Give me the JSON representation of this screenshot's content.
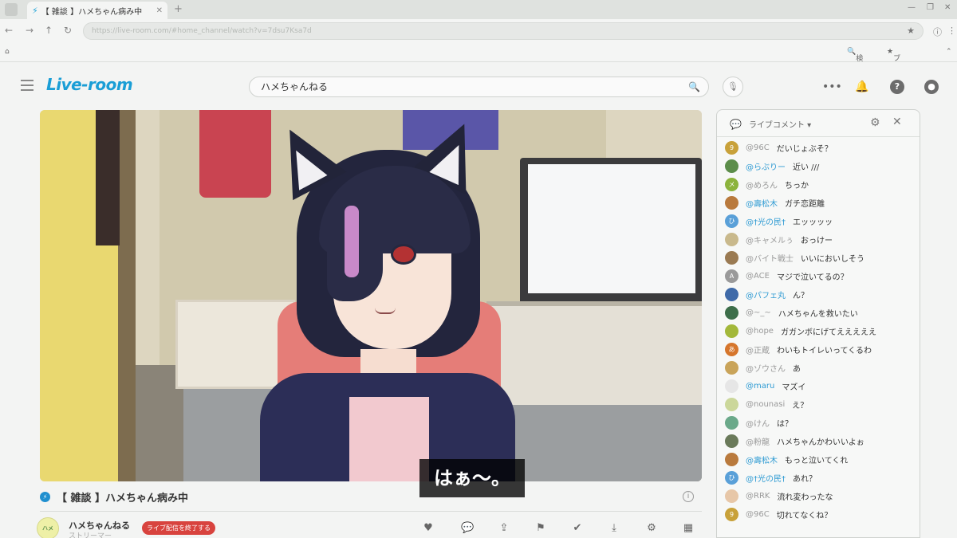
{
  "browser": {
    "tab_label": "【 雑談 】ハメちゃん病み中",
    "url": "https://live-room.com/#home_channel/watch?v=7dsu7Ksa7d",
    "bookmarks": [
      "検索",
      "ブックマーク"
    ]
  },
  "header": {
    "logo": "Live-room",
    "search_value": "ハメちゃんねる"
  },
  "video": {
    "subtitle": "はぁ～。",
    "title": "【 雑談 】ハメちゃん病み中"
  },
  "channel": {
    "avatar_text": "ハメ",
    "name": "ハメちゃんねる",
    "sub": "ストリーマー",
    "end_live_label": "ライブ配信を終了する"
  },
  "actions": [
    "heart-icon",
    "comment-icon",
    "share-icon",
    "flag-icon",
    "check-icon",
    "download-icon",
    "settings-icon",
    "grid-icon"
  ],
  "chat": {
    "title": "ライブコメント ▾",
    "messages": [
      {
        "user": "@96C",
        "text": "だいじょぶそ？",
        "avatar": "9",
        "color": "#c8a13a",
        "hl": false
      },
      {
        "user": "@らぶりー",
        "text": "近い ///",
        "avatar": "",
        "color": "#5c8d4a",
        "hl": true
      },
      {
        "user": "@めろん",
        "text": "ちっか",
        "avatar": "メ",
        "color": "#8cb33c",
        "hl": false
      },
      {
        "user": "@壽松木",
        "text": "ガチ恋距離",
        "avatar": "",
        "color": "#b97a3d",
        "hl": true
      },
      {
        "user": "@†光の民†",
        "text": "エッッッッ",
        "avatar": "ひ",
        "color": "#5aa0d8",
        "hl": true
      },
      {
        "user": "@キャメルぅ",
        "text": "おっけー",
        "avatar": "",
        "color": "#c9b98c",
        "hl": false
      },
      {
        "user": "@バイト戦士",
        "text": "いいにおいしそう",
        "avatar": "",
        "color": "#9a7a52",
        "hl": false
      },
      {
        "user": "@ACE",
        "text": "マジで泣いてるの？",
        "avatar": "A",
        "color": "#9a9a9a",
        "hl": false
      },
      {
        "user": "@パフェ丸",
        "text": "ん？",
        "avatar": "",
        "color": "#3f6aa8",
        "hl": true
      },
      {
        "user": "@~_~",
        "text": "ハメちゃんを救いたい",
        "avatar": "",
        "color": "#3d6e4a",
        "hl": false
      },
      {
        "user": "@hope",
        "text": "ガガンボにげてえええええ",
        "avatar": "",
        "color": "#a3b83a",
        "hl": false
      },
      {
        "user": "@正蔵",
        "text": "わいもトイレいってくるわ",
        "avatar": "あ",
        "color": "#d6762c",
        "hl": false
      },
      {
        "user": "@ゾウさん",
        "text": "あ",
        "avatar": "",
        "color": "#c9a45a",
        "hl": false
      },
      {
        "user": "@maru",
        "text": "マズイ",
        "avatar": "",
        "color": "#e6e6e6",
        "hl": true
      },
      {
        "user": "@nounasi",
        "text": "え？",
        "avatar": "",
        "color": "#cbd79a",
        "hl": false
      },
      {
        "user": "@けん",
        "text": "は？",
        "avatar": "",
        "color": "#6ba98a",
        "hl": false
      },
      {
        "user": "@粉龍",
        "text": "ハメちゃんかわいいよぉ",
        "avatar": "",
        "color": "#6a7a5a",
        "hl": false
      },
      {
        "user": "@壽松木",
        "text": "もっと泣いてくれ",
        "avatar": "",
        "color": "#b97a3d",
        "hl": true
      },
      {
        "user": "@†光の民†",
        "text": "あれ？",
        "avatar": "ひ",
        "color": "#5aa0d8",
        "hl": true
      },
      {
        "user": "@RRK",
        "text": "流れ変わったな",
        "avatar": "",
        "color": "#e7c7a8",
        "hl": false
      },
      {
        "user": "@96C",
        "text": "切れてなくね？",
        "avatar": "9",
        "color": "#c8a13a",
        "hl": false
      }
    ]
  }
}
